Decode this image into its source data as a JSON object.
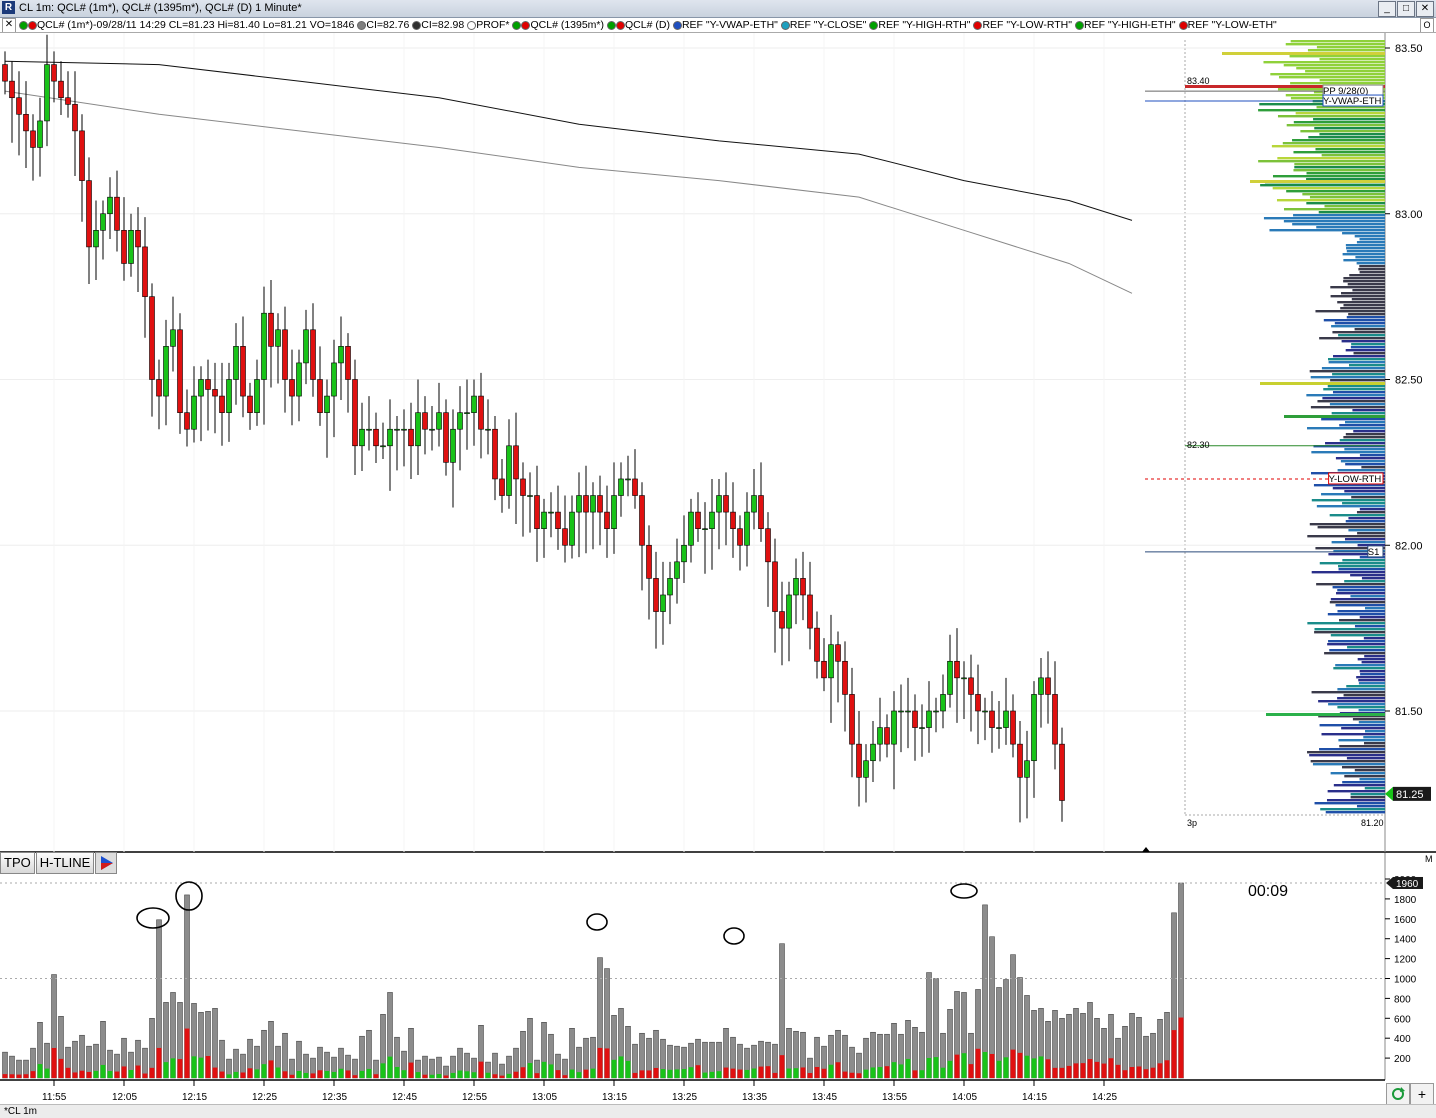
{
  "window": {
    "app_icon_glyph": "R",
    "title": "CL 1m: QCL# (1m*), QCL# (1395m*), QCL# (D) 1 Minute*",
    "buttons": [
      "_",
      "□",
      "✕"
    ]
  },
  "legend": {
    "close_glyph": "✕",
    "option_glyph": "O",
    "items": [
      {
        "text": "QCL# (1m*)-09/28/11 14:29 CL=81.23 Hi=81.40 Lo=81.21 VO=1846",
        "colors": [
          "#00a000",
          "#e00000"
        ]
      },
      {
        "text": "CI=82.76",
        "colors": [
          "#808080"
        ]
      },
      {
        "text": "CI=82.98",
        "colors": [
          "#303030"
        ]
      },
      {
        "text": "PROF*",
        "colors": [
          "#ffffff"
        ]
      },
      {
        "text": "QCL# (1395m*)",
        "colors": [
          "#00a000",
          "#e00000"
        ]
      },
      {
        "text": "QCL# (D)",
        "colors": [
          "#00a000",
          "#e00000"
        ]
      },
      {
        "text": "REF \"Y-VWAP-ETH\"",
        "colors": [
          "#1f4fbf"
        ]
      },
      {
        "text": "REF \"Y-CLOSE\"",
        "colors": [
          "#1fa0bf"
        ]
      },
      {
        "text": "REF \"Y-HIGH-RTH\"",
        "colors": [
          "#00a000"
        ]
      },
      {
        "text": "REF \"Y-LOW-RTH\"",
        "colors": [
          "#e00000"
        ]
      },
      {
        "text": "REF \"Y-HIGH-ETH\"",
        "colors": [
          "#00a000"
        ]
      },
      {
        "text": "REF \"Y-LOW-ETH\"",
        "colors": [
          "#e00000"
        ]
      }
    ]
  },
  "price_axis": {
    "ticks": [
      "83.50",
      "83.00",
      "82.50",
      "82.00",
      "81.50"
    ],
    "current_price": "81.25",
    "bottom_label": "81.20"
  },
  "profile": {
    "label_high": "83.40",
    "label_mid": "82.30",
    "period_label": "3p"
  },
  "ref_labels": {
    "pp": "PP 9/28(0)",
    "vwap": "Y-VWAP-ETH",
    "ylow": "Y-LOW-RTH",
    "s1": "S1"
  },
  "volume_axis": {
    "ticks": [
      "2000",
      "1800",
      "1600",
      "1400",
      "1200",
      "1000",
      "800",
      "600",
      "400",
      "200"
    ],
    "current_volume": "1960",
    "panel_marker": "M"
  },
  "time_axis": [
    "11:55",
    "12:05",
    "12:15",
    "12:25",
    "12:35",
    "12:45",
    "12:55",
    "13:05",
    "13:15",
    "13:25",
    "13:35",
    "13:45",
    "13:55",
    "14:05",
    "14:15",
    "14:25"
  ],
  "lower_tabs": {
    "tpo": "TPO",
    "hline": "H-TLINE"
  },
  "timer": "00:09",
  "status": {
    "tab": "*CL 1m",
    "refresh_icon": "refresh-icon",
    "add_glyph": "+"
  },
  "colors": {
    "up": "#19c319",
    "down": "#e01010",
    "volume_up": "#19c319",
    "volume_down": "#e01010",
    "volume_total": "#8c8c8c"
  },
  "chart_data": [
    {
      "type": "candlestick",
      "title": "",
      "interval": "1 Minute",
      "x_range": [
        "11:48",
        "14:29"
      ],
      "ylim": [
        81.2,
        83.55
      ],
      "closes": [
        83.4,
        83.35,
        83.3,
        83.25,
        83.2,
        83.28,
        83.45,
        83.4,
        83.35,
        83.33,
        83.25,
        83.1,
        82.9,
        82.95,
        83.0,
        83.05,
        82.95,
        82.85,
        82.95,
        82.9,
        82.75,
        82.5,
        82.45,
        82.6,
        82.65,
        82.4,
        82.35,
        82.45,
        82.5,
        82.47,
        82.45,
        82.4,
        82.5,
        82.6,
        82.45,
        82.4,
        82.5,
        82.7,
        82.6,
        82.65,
        82.5,
        82.45,
        82.55,
        82.65,
        82.5,
        82.4,
        82.45,
        82.55,
        82.6,
        82.5,
        82.3,
        82.35,
        82.35,
        82.3,
        82.3,
        82.35,
        82.35,
        82.35,
        82.3,
        82.4,
        82.35,
        82.35,
        82.4,
        82.25,
        82.35,
        82.4,
        82.4,
        82.45,
        82.35,
        82.35,
        82.2,
        82.15,
        82.3,
        82.2,
        82.15,
        82.15,
        82.05,
        82.1,
        82.1,
        82.05,
        82.0,
        82.1,
        82.15,
        82.1,
        82.15,
        82.1,
        82.05,
        82.15,
        82.2,
        82.2,
        82.15,
        82.0,
        81.9,
        81.8,
        81.85,
        81.9,
        81.95,
        82.0,
        82.1,
        82.05,
        82.05,
        82.1,
        82.15,
        82.1,
        82.05,
        82.0,
        82.1,
        82.15,
        82.05,
        81.95,
        81.8,
        81.75,
        81.85,
        81.9,
        81.85,
        81.75,
        81.65,
        81.6,
        81.7,
        81.65,
        81.55,
        81.4,
        81.3,
        81.35,
        81.4,
        81.45,
        81.4,
        81.5,
        81.5,
        81.5,
        81.45,
        81.45,
        81.5,
        81.5,
        81.55,
        81.65,
        81.6,
        81.6,
        81.55,
        81.5,
        81.5,
        81.45,
        81.45,
        81.5,
        81.4,
        81.3,
        81.35,
        81.55,
        81.6,
        81.55,
        81.4,
        81.23
      ],
      "series": [
        {
          "name": "CI=82.76",
          "x": [
            "11:48",
            "12:10",
            "12:30",
            "12:50",
            "13:10",
            "13:30",
            "13:50",
            "14:05",
            "14:20",
            "14:29"
          ],
          "y": [
            83.37,
            83.3,
            83.25,
            83.2,
            83.14,
            83.1,
            83.05,
            82.95,
            82.85,
            82.76
          ]
        },
        {
          "name": "CI=82.98",
          "x": [
            "11:48",
            "12:10",
            "12:30",
            "12:50",
            "13:10",
            "13:30",
            "13:50",
            "14:05",
            "14:20",
            "14:29"
          ],
          "y": [
            83.46,
            83.45,
            83.4,
            83.35,
            83.27,
            83.22,
            83.18,
            83.1,
            83.04,
            82.98
          ]
        }
      ],
      "reference_levels": [
        {
          "name": "PP 9/28(0)",
          "value": 83.37
        },
        {
          "name": "Y-VWAP-ETH",
          "value": 83.34
        },
        {
          "name": "Y-LOW-RTH",
          "value": 82.2
        },
        {
          "name": "S1",
          "value": 81.98
        }
      ]
    },
    {
      "type": "bar",
      "title": "",
      "ylim": [
        0,
        2000
      ],
      "volumes": [
        260,
        220,
        180,
        180,
        300,
        560,
        350,
        1040,
        620,
        310,
        370,
        430,
        320,
        340,
        570,
        280,
        240,
        400,
        260,
        380,
        300,
        600,
        1590,
        760,
        860,
        760,
        1840,
        750,
        660,
        670,
        700,
        380,
        190,
        290,
        240,
        390,
        320,
        480,
        570,
        320,
        450,
        190,
        370,
        240,
        200,
        310,
        260,
        210,
        300,
        230,
        190,
        420,
        480,
        180,
        640,
        860,
        410,
        270,
        500,
        180,
        220,
        190,
        210,
        120,
        220,
        300,
        250,
        200,
        530,
        160,
        250,
        140,
        220,
        300,
        470,
        600,
        180,
        560,
        440,
        240,
        190,
        500,
        310,
        400,
        410,
        1210,
        1100,
        630,
        700,
        520,
        340,
        450,
        400,
        480,
        390,
        330,
        320,
        310,
        350,
        390,
        360,
        360,
        360,
        500,
        410,
        340,
        300,
        330,
        370,
        360,
        340,
        1350,
        500,
        470,
        460,
        200,
        410,
        320,
        430,
        480,
        430,
        310,
        250,
        400,
        460,
        440,
        440,
        550,
        440,
        580,
        510,
        460,
        1060,
        1000,
        450,
        690,
        870,
        860,
        450,
        890,
        1740,
        1420,
        910,
        990,
        1240,
        1010,
        830,
        680,
        700,
        570,
        680,
        600,
        640,
        700,
        650,
        760,
        600,
        500,
        640,
        400,
        520,
        650,
        610,
        420,
        450,
        590,
        660,
        1660,
        1960
      ]
    }
  ]
}
